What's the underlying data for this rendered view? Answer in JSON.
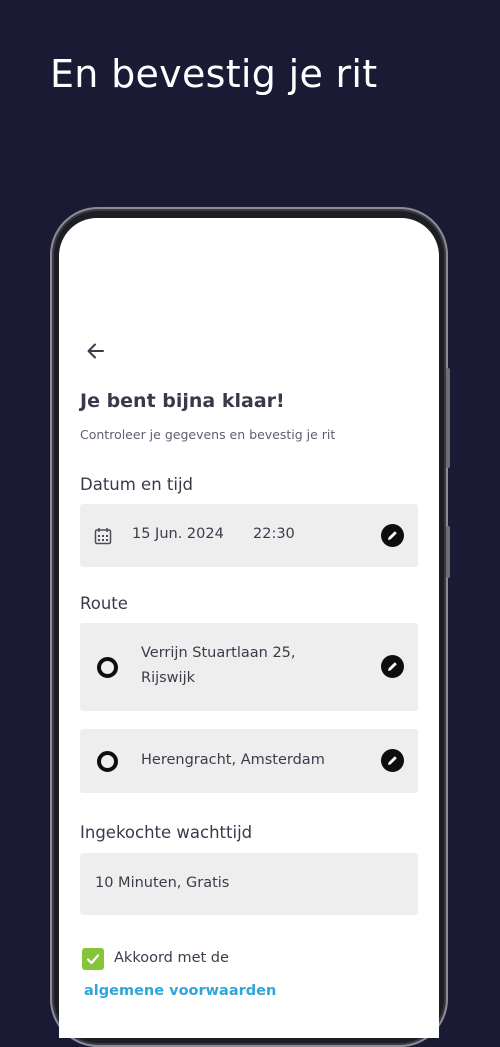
{
  "headline": "En bevestig je rit",
  "screen": {
    "title": "Je bent bijna klaar!",
    "subtitle": "Controleer je gegevens en bevestig je rit",
    "date_time": {
      "label": "Datum en tijd",
      "date": "15 Jun. 2024",
      "time": "22:30"
    },
    "route": {
      "label": "Route",
      "from_line1": "Verrijn Stuartlaan 25,",
      "from_line2": "Rijswijk",
      "to": "Herengracht, Amsterdam"
    },
    "waiting": {
      "label": "Ingekochte wachttijd",
      "value": "10 Minuten, Gratis"
    },
    "agreement": {
      "text": "Akkoord met de",
      "link": "algemene voorwaarden",
      "checked": true
    }
  },
  "colors": {
    "background": "#1b1a35",
    "card": "#eeeeee",
    "checkbox": "#86c43a",
    "link": "#2fa6d9"
  },
  "icons": [
    "arrow-left-icon",
    "calendar-icon",
    "pencil-icon",
    "location-ring-icon",
    "checkmark-icon"
  ]
}
